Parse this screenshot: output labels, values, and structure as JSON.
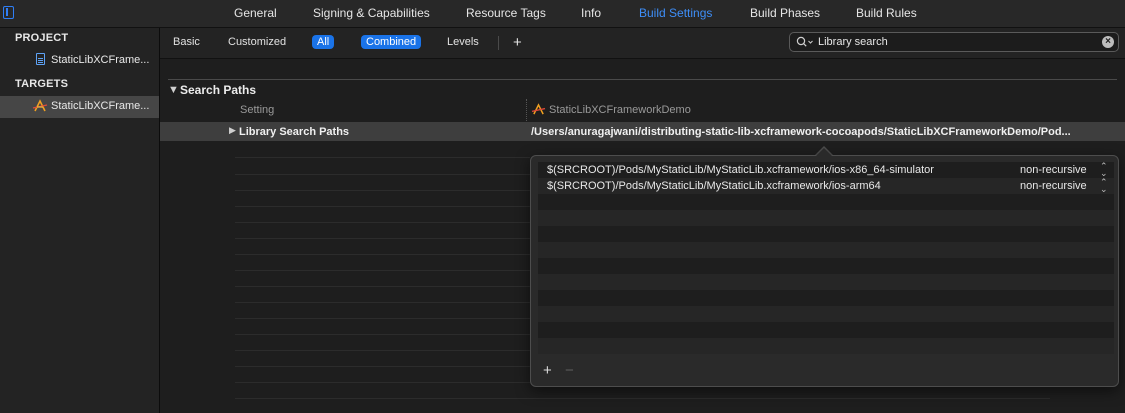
{
  "tabs": [
    {
      "label": "General",
      "active": false
    },
    {
      "label": "Signing & Capabilities",
      "active": false
    },
    {
      "label": "Resource Tags",
      "active": false
    },
    {
      "label": "Info",
      "active": false
    },
    {
      "label": "Build Settings",
      "active": true
    },
    {
      "label": "Build Phases",
      "active": false
    },
    {
      "label": "Build Rules",
      "active": false
    }
  ],
  "sidebar": {
    "project_header": "PROJECT",
    "project_item": "StaticLibXCFrame...",
    "targets_header": "TARGETS",
    "target_item": "StaticLibXCFrame..."
  },
  "filters": {
    "basic": "Basic",
    "customized": "Customized",
    "all": "All",
    "combined": "Combined",
    "levels": "Levels",
    "add": "+"
  },
  "search": {
    "value": "Library search",
    "placeholder": "Filter"
  },
  "section": {
    "title": "Search Paths",
    "col_setting": "Setting",
    "col_target": "StaticLibXCFrameworkDemo"
  },
  "setting_row": {
    "name": "Library Search Paths",
    "value": "/Users/anuragajwani/distributing-static-lib-xcframework-cocoapods/StaticLibXCFrameworkDemo/Pod..."
  },
  "popover": {
    "entries": [
      {
        "path": "$(SRCROOT)/Pods/MyStaticLib/MyStaticLib.xcframework/ios-x86_64-simulator",
        "mode": "non-recursive"
      },
      {
        "path": "$(SRCROOT)/Pods/MyStaticLib/MyStaticLib.xcframework/ios-arm64",
        "mode": "non-recursive"
      }
    ],
    "add": "+",
    "remove": "−"
  },
  "colors": {
    "accent": "#3e8ef7",
    "toggle_on": "#1a73e8",
    "background": "#1e1e1e",
    "selected_row": "#3e3e3e"
  }
}
